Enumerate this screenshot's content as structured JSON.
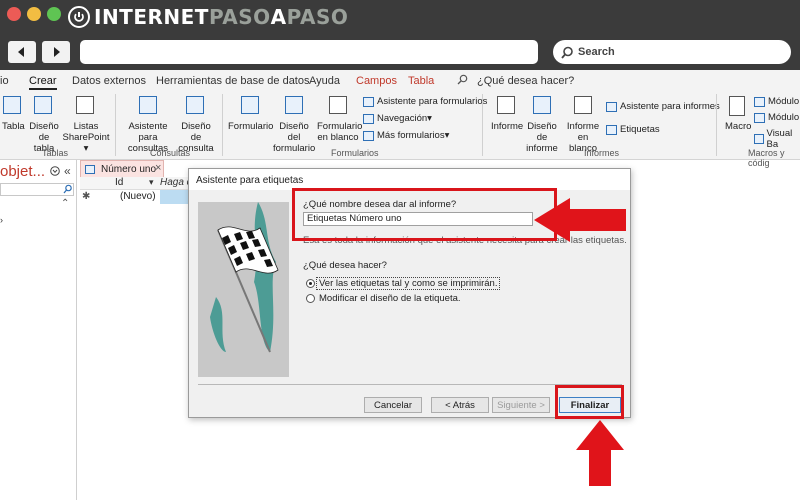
{
  "brand": {
    "part1": "INTERNET",
    "part2": "PASO",
    "part3": "A",
    "part4": "PASO"
  },
  "browser": {
    "search_placeholder": "Search"
  },
  "ribbon": {
    "tabs": [
      {
        "label": "io",
        "color": "#333333"
      },
      {
        "label": "Crear",
        "color": "#111111"
      },
      {
        "label": "Datos externos",
        "color": "#333333"
      },
      {
        "label": "Herramientas de base de datos",
        "color": "#333333"
      },
      {
        "label": "Ayuda",
        "color": "#333333"
      },
      {
        "label": "Campos",
        "color": "#c0392b"
      },
      {
        "label": "Tabla",
        "color": "#c0392b"
      }
    ],
    "tell_me": "¿Qué desea hacer?",
    "tablas": {
      "label": "Tablas",
      "tabla": "Tabla",
      "diseno_tabla_1": "Diseño",
      "diseno_tabla_2": "de tabla",
      "listas_1": "Listas",
      "listas_2": "SharePoint"
    },
    "consultas": {
      "label": "Consultas",
      "asistente_1": "Asistente para",
      "asistente_2": "consultas",
      "diseno_1": "Diseño de",
      "diseno_2": "consulta"
    },
    "formularios": {
      "label": "Formularios",
      "formulario": "Formulario",
      "diseno_1": "Diseño del",
      "diseno_2": "formulario",
      "blanco_1": "Formulario",
      "blanco_2": "en blanco",
      "asistente": "Asistente para formularios",
      "navegacion": "Navegación",
      "mas": "Más formularios"
    },
    "informes": {
      "label": "Informes",
      "informe": "Informe",
      "diseno_1": "Diseño de",
      "diseno_2": "informe",
      "blanco_1": "Informe",
      "blanco_2": "en blanco",
      "asistente": "Asistente para informes",
      "etiquetas": "Etiquetas"
    },
    "macros": {
      "label": "Macros y códig",
      "macro": "Macro",
      "modulo1": "Módulo",
      "modulo2": "Módulo",
      "visual": "Visual Ba"
    }
  },
  "navpane": {
    "title": "objet..."
  },
  "table": {
    "tab_label": "Número uno",
    "col_id": "Id",
    "col_add": "Haga c",
    "new_row": "(Nuevo)"
  },
  "dialog": {
    "title": "Asistente para etiquetas",
    "q_name": "¿Qué nombre desea dar al informe?",
    "name_value": "Etiquetas Número uno",
    "info": "Esa es toda la información que el asistente necesita para crear las etiquetas.",
    "q_do": "¿Qué desea hacer?",
    "opt_view": "Ver las etiquetas tal y como se imprimirán.",
    "opt_modify": "Modificar el diseño de la etiqueta.",
    "btn_cancel": "Cancelar",
    "btn_back": "< Atrás",
    "btn_next": "Siguiente >",
    "btn_finish": "Finalizar"
  },
  "colors": {
    "annotation_red": "#d9151b",
    "access_red": "#c0392b"
  }
}
